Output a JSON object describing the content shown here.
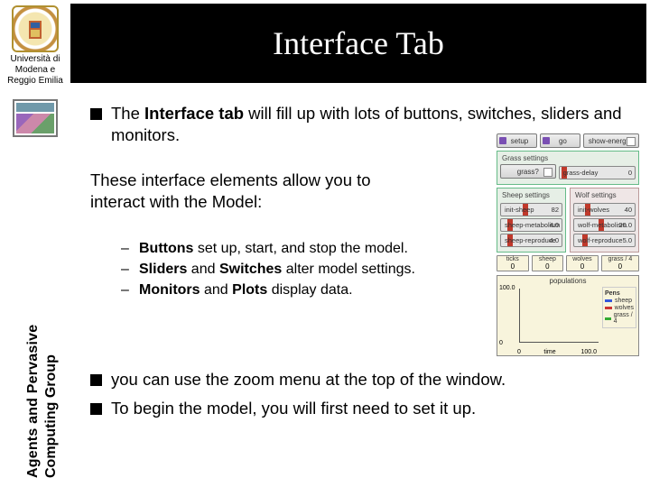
{
  "sidebar": {
    "university": "Università di Modena e Reggio Emilia",
    "group_line1": "Agents and Pervasive",
    "group_line2": "Computing Group"
  },
  "title": "Interface Tab",
  "body": {
    "p1_pre": "The ",
    "p1_bold": "Interface tab",
    "p1_post": " will fill up with lots of buttons, switches, sliders and monitors.",
    "p2a": "These interface elements allow you to",
    "p2b": "interact with the Model:",
    "s1_b": "Buttons",
    "s1_t": " set up, start, and stop the model.",
    "s2_b1": "Sliders",
    "s2_mid": " and ",
    "s2_b2": "Switches",
    "s2_t": " alter model settings.",
    "s3_b1": "Monitors",
    "s3_mid": " and ",
    "s3_b2": "Plots",
    "s3_t": " display data.",
    "p3": "you can use the zoom menu at the top of the window.",
    "p4": "To begin the model, you will first need to set it up."
  },
  "widgets": {
    "setup": "setup",
    "go": "go",
    "grass_title": "Grass settings",
    "sheep_title": "Sheep settings",
    "wolf_title": "Wolf settings",
    "show_energy": "show-energy?",
    "grass_sw": {
      "label": "grass?"
    },
    "grass_delay": {
      "label": "grass-delay",
      "val": "0"
    },
    "init_sheep": {
      "label": "init-sheep",
      "val": "82"
    },
    "init_wolves": {
      "label": "init-wolves",
      "val": "40"
    },
    "sheep_metab": {
      "label": "sheep-metabolism",
      "val": "4.0"
    },
    "wolf_metab": {
      "label": "wolf-metabolism",
      "val": "20.0"
    },
    "sheep_repro": {
      "label": "sheep-reproduce",
      "val": "4.0"
    },
    "wolf_repro": {
      "label": "wolf-reproduce",
      "val": "5.0"
    },
    "mon_ticks": {
      "label": "ticks",
      "val": "0"
    },
    "mon_sheep": {
      "label": "sheep",
      "val": "0"
    },
    "mon_wolves": {
      "label": "wolves",
      "val": "0"
    },
    "mon_grass": {
      "label": "grass / 4",
      "val": "0"
    },
    "plot": {
      "title": "populations",
      "ymax": "100.0",
      "ymin": "0",
      "xmin": "0",
      "xmax": "100.0",
      "xlabel": "time",
      "leg_title": "Pens",
      "leg1": "sheep",
      "leg2": "wolves",
      "leg3": "grass / 4"
    }
  },
  "dash": "–"
}
